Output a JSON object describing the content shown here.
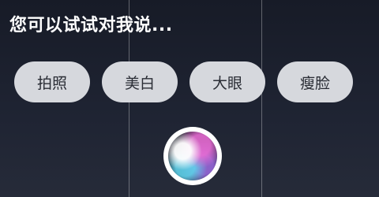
{
  "prompt": {
    "text": "您可以试试对我说..."
  },
  "suggestions": [
    {
      "label": "拍照"
    },
    {
      "label": "美白"
    },
    {
      "label": "大眼"
    },
    {
      "label": "瘦脸"
    }
  ],
  "assistant": {
    "icon": "voice-assistant-orb-icon"
  },
  "colors": {
    "background": "#1f2433",
    "chip_background": "#d6d8dd",
    "chip_text": "#2a2d35",
    "prompt_text": "#ffffff"
  }
}
